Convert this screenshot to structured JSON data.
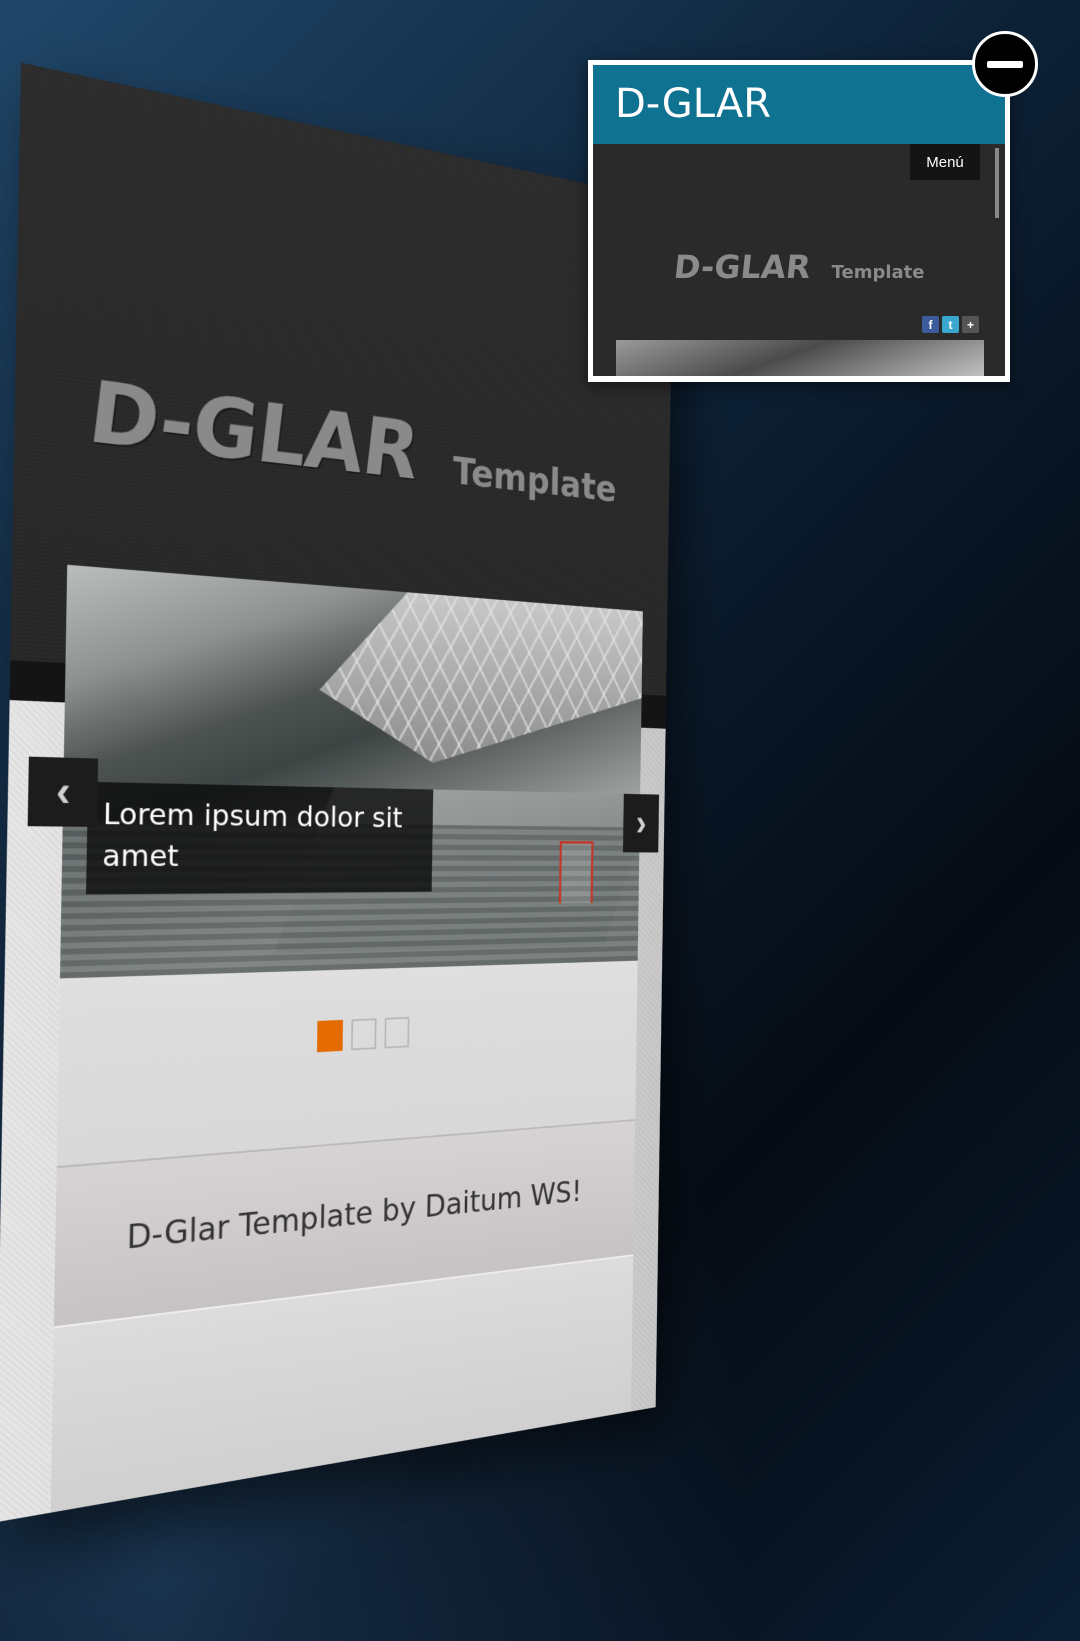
{
  "site": {
    "logo_main": "D-GLAR",
    "logo_sub": "Template",
    "social": [
      {
        "name": "facebook",
        "glyph": "f",
        "color": "#3b5b9a"
      },
      {
        "name": "twitter",
        "glyph": "t",
        "color": "#3aa7cf"
      },
      {
        "name": "google-plus",
        "glyph": "+",
        "color": "#555555"
      }
    ],
    "slider": {
      "caption": "Lorem ipsum dolor sit amet",
      "prev_glyph": "‹",
      "next_glyph": "›",
      "active_slide": 1,
      "slide_count": 3,
      "active_color": "#e36b00"
    },
    "tagline": "D-Glar Template by Daitum WS!"
  },
  "preview": {
    "title": "D-GLAR",
    "menu_label": "Menú",
    "header_color": "#0f7291",
    "logo_main": "D-GLAR",
    "logo_sub": "Template"
  }
}
